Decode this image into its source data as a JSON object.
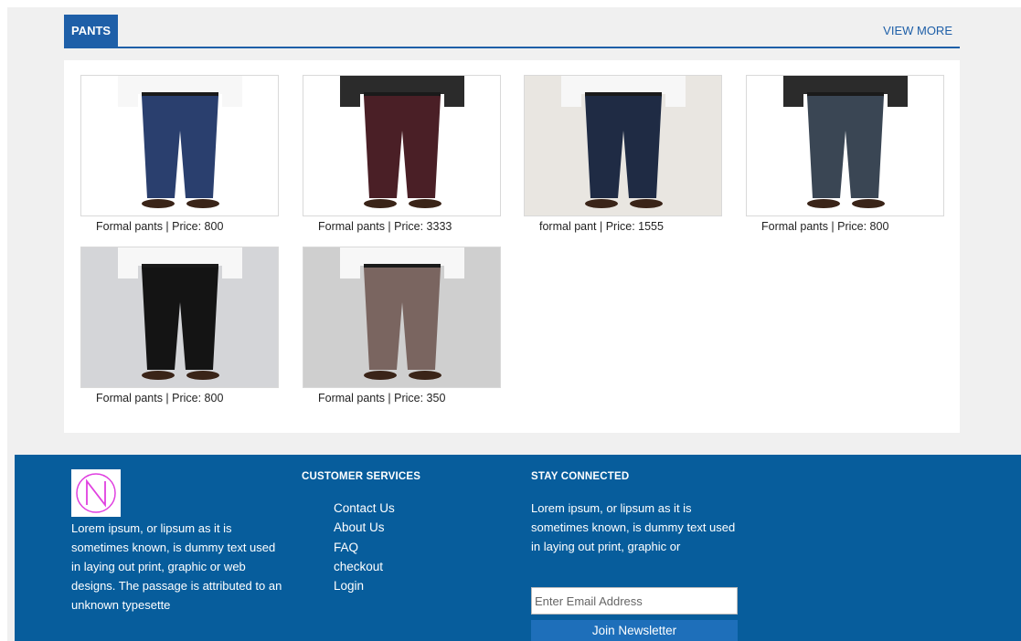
{
  "section": {
    "title": "PANTS",
    "view_more": "VIEW MORE"
  },
  "products": [
    {
      "caption": "Formal pants | Price: 800",
      "pants_color": "#2a3f6e",
      "bg": "#ffffff"
    },
    {
      "caption": "Formal pants | Price: 3333",
      "pants_color": "#4a1f26",
      "bg": "#ffffff"
    },
    {
      "caption": "formal pant | Price: 1555",
      "pants_color": "#1f2b44",
      "bg": "#e9e6e1"
    },
    {
      "caption": "Formal pants | Price: 800",
      "pants_color": "#3a4654",
      "bg": "#ffffff"
    },
    {
      "caption": "Formal pants | Price: 800",
      "pants_color": "#141414",
      "bg": "#d4d5d8"
    },
    {
      "caption": "Formal pants | Price: 350",
      "pants_color": "#7a6560",
      "bg": "#cfcfcf"
    }
  ],
  "footer": {
    "about_text": "Lorem ipsum, or lipsum as it is sometimes known, is dummy text used in laying out print, graphic or web designs. The passage is attributed to an unknown typesette",
    "customer_services": {
      "title": "CUSTOMER SERVICES",
      "links": [
        "Contact Us",
        "About Us",
        "FAQ",
        "checkout",
        "Login"
      ]
    },
    "stay_connected": {
      "title": "STAY CONNECTED",
      "text": "Lorem ipsum, or lipsum as it is sometimes known, is dummy text used in laying out print, graphic or"
    },
    "email_placeholder": "Enter Email Address",
    "join_label": "Join Newsletter"
  },
  "colors": {
    "brand_blue": "#1e5fa8",
    "footer_bg": "#075d9c",
    "logo_accent": "#e040e0"
  }
}
